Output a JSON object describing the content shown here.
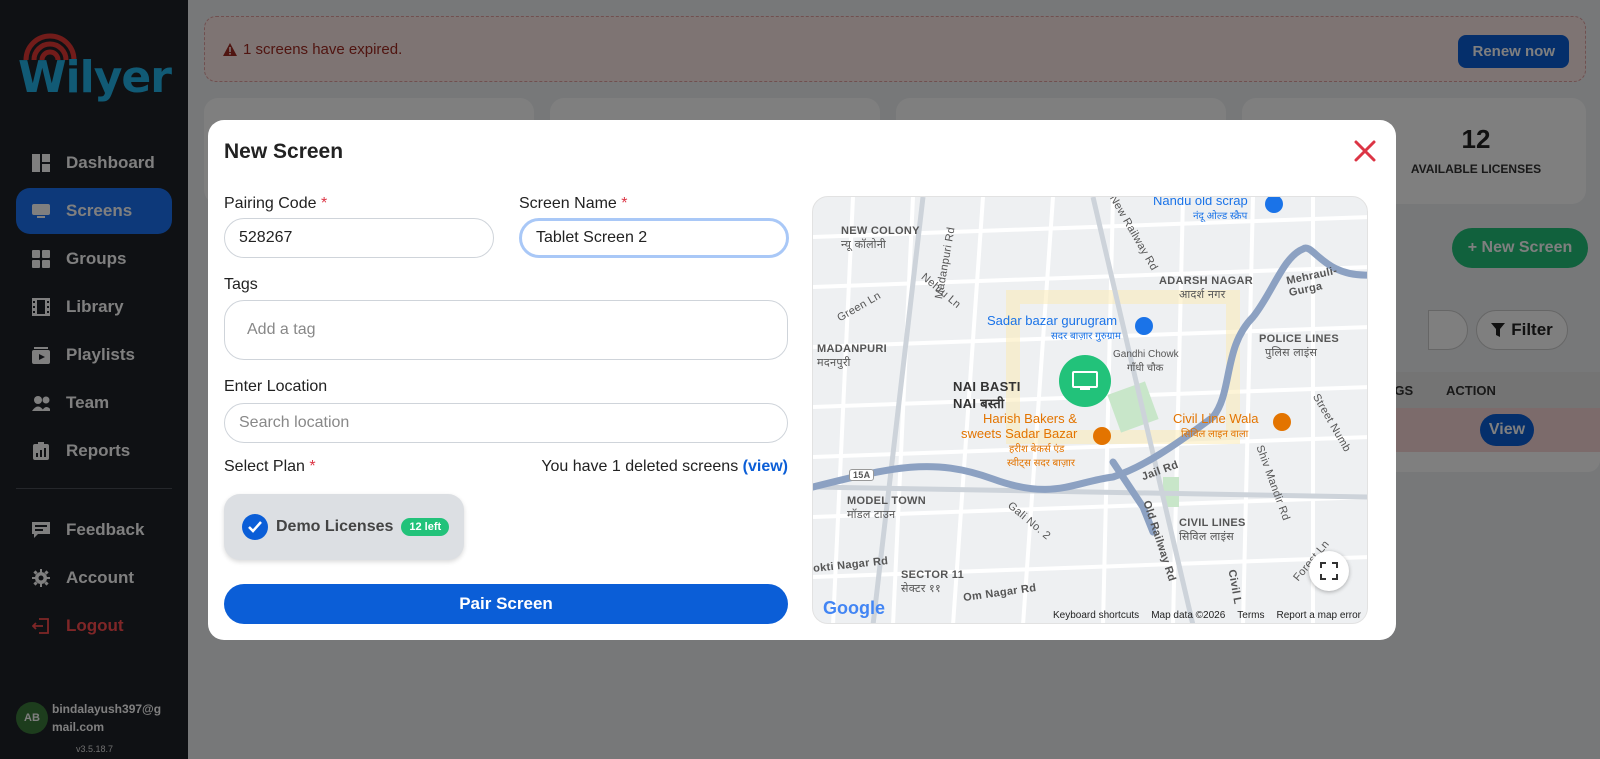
{
  "sidebar": {
    "logo": "Wilyer",
    "items": [
      {
        "label": "Dashboard",
        "icon": "dashboard-icon"
      },
      {
        "label": "Screens",
        "icon": "screen-icon",
        "active": true
      },
      {
        "label": "Groups",
        "icon": "groups-icon"
      },
      {
        "label": "Library",
        "icon": "film-icon"
      },
      {
        "label": "Playlists",
        "icon": "playlist-icon"
      },
      {
        "label": "Team",
        "icon": "team-icon"
      },
      {
        "label": "Reports",
        "icon": "reports-icon"
      }
    ],
    "secondary": [
      {
        "label": "Feedback",
        "icon": "feedback-icon"
      },
      {
        "label": "Account",
        "icon": "gear-icon"
      },
      {
        "label": "Logout",
        "icon": "logout-icon"
      }
    ],
    "user": {
      "initials": "AB",
      "email": "bindalayush397@gmail.com"
    },
    "version": "v3.5.18.7"
  },
  "alert": {
    "text": "1 screens have expired.",
    "button": "Renew now"
  },
  "stats": {
    "available_licenses": {
      "value": "12",
      "label": "AVAILABLE LICENSES"
    }
  },
  "toolbar": {
    "new_screen": "+ New Screen",
    "filter": "Filter"
  },
  "table": {
    "headers": [
      "TAGS",
      "ACTION"
    ],
    "row_action": "View"
  },
  "modal": {
    "title": "New Screen",
    "pairing_code": {
      "label": "Pairing Code",
      "value": "528267"
    },
    "screen_name": {
      "label": "Screen Name",
      "value": "Tablet Screen 2"
    },
    "tags": {
      "label": "Tags",
      "placeholder": "Add a tag"
    },
    "location": {
      "label": "Enter Location",
      "placeholder": "Search location"
    },
    "plan": {
      "label": "Select Plan",
      "deleted_note": "You have 1 deleted screens",
      "deleted_link": "(view)",
      "option": "Demo Licenses",
      "badge": "12 left"
    },
    "submit": "Pair Screen",
    "map": {
      "labels": [
        "NEW COLONY",
        "न्यू कॉलोनी",
        "ADARSH NAGAR",
        "आदर्श नगर",
        "MADANPURI",
        "मदनपुरी",
        "NAI BASTI",
        "NAI बस्ती",
        "POLICE LINES",
        "पुलिस लाइंस",
        "MODEL TOWN",
        "मॉडल टाउन",
        "CIVIL LINES",
        "सिविल लाइंस",
        "SECTOR 11",
        "सेक्टर ११"
      ],
      "pois": [
        "Nandu old scrap",
        "नंदू ओल्ड स्क्रैप",
        "Sadar bazar gurugram",
        "सदर बाज़ार गुरुग्राम",
        "Gandhi Chowk",
        "गाँधी चौक",
        "Harish Bakers &",
        "sweets Sadar Bazar",
        "हरीश बेकर्स एंड",
        "स्वीट्स सदर बाज़ार",
        "Civil Line Wala",
        "सिविल लाइन वाला"
      ],
      "roads": [
        "Madanpuri Rd",
        "New Railway Rd",
        "Nehru Ln",
        "Green Ln",
        "Mehrauli-Gurga",
        "Jail Rd",
        "Old Railway Rd",
        "Gali No. 2",
        "Om Nagar Rd",
        "okti Nagar Rd",
        "Shiv Mandir Rd",
        "Street Numb",
        "Forest Ln",
        "Civil L",
        "15A"
      ],
      "footer": [
        "Keyboard shortcuts",
        "Map data ©2026",
        "Terms",
        "Report a map error"
      ],
      "brand": "Google"
    }
  },
  "colors": {
    "primary": "#0b5ed7",
    "success": "#22c27a",
    "danger": "#dc3545",
    "sidebar": "#1f2329"
  }
}
